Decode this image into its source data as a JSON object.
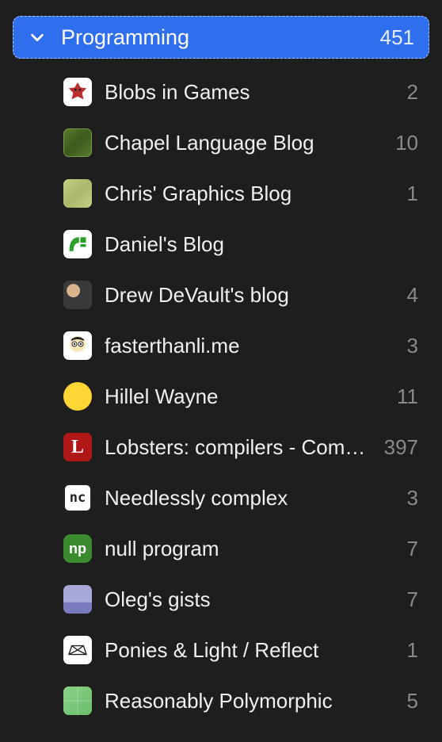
{
  "folder": {
    "name": "Programming",
    "count": "451"
  },
  "feeds": [
    {
      "name": "Blobs in Games",
      "count": "2",
      "icon": "blobs"
    },
    {
      "name": "Chapel Language Blog",
      "count": "10",
      "icon": "chapel"
    },
    {
      "name": "Chris' Graphics Blog",
      "count": "1",
      "icon": "chris"
    },
    {
      "name": "Daniel's Blog",
      "count": "",
      "icon": "daniel"
    },
    {
      "name": "Drew DeVault's blog",
      "count": "4",
      "icon": "drew"
    },
    {
      "name": "fasterthanli.me",
      "count": "3",
      "icon": "faster"
    },
    {
      "name": "Hillel Wayne",
      "count": "11",
      "icon": "hillel"
    },
    {
      "name": "Lobsters: compilers - Compilers",
      "count": "397",
      "icon": "lobsters"
    },
    {
      "name": "Needlessly complex",
      "count": "3",
      "icon": "needlessly"
    },
    {
      "name": "null program",
      "count": "7",
      "icon": "null"
    },
    {
      "name": "Oleg's gists",
      "count": "7",
      "icon": "oleg"
    },
    {
      "name": "Ponies & Light / Reflect",
      "count": "1",
      "icon": "ponies"
    },
    {
      "name": "Reasonably Polymorphic",
      "count": "5",
      "icon": "reasonably"
    }
  ]
}
